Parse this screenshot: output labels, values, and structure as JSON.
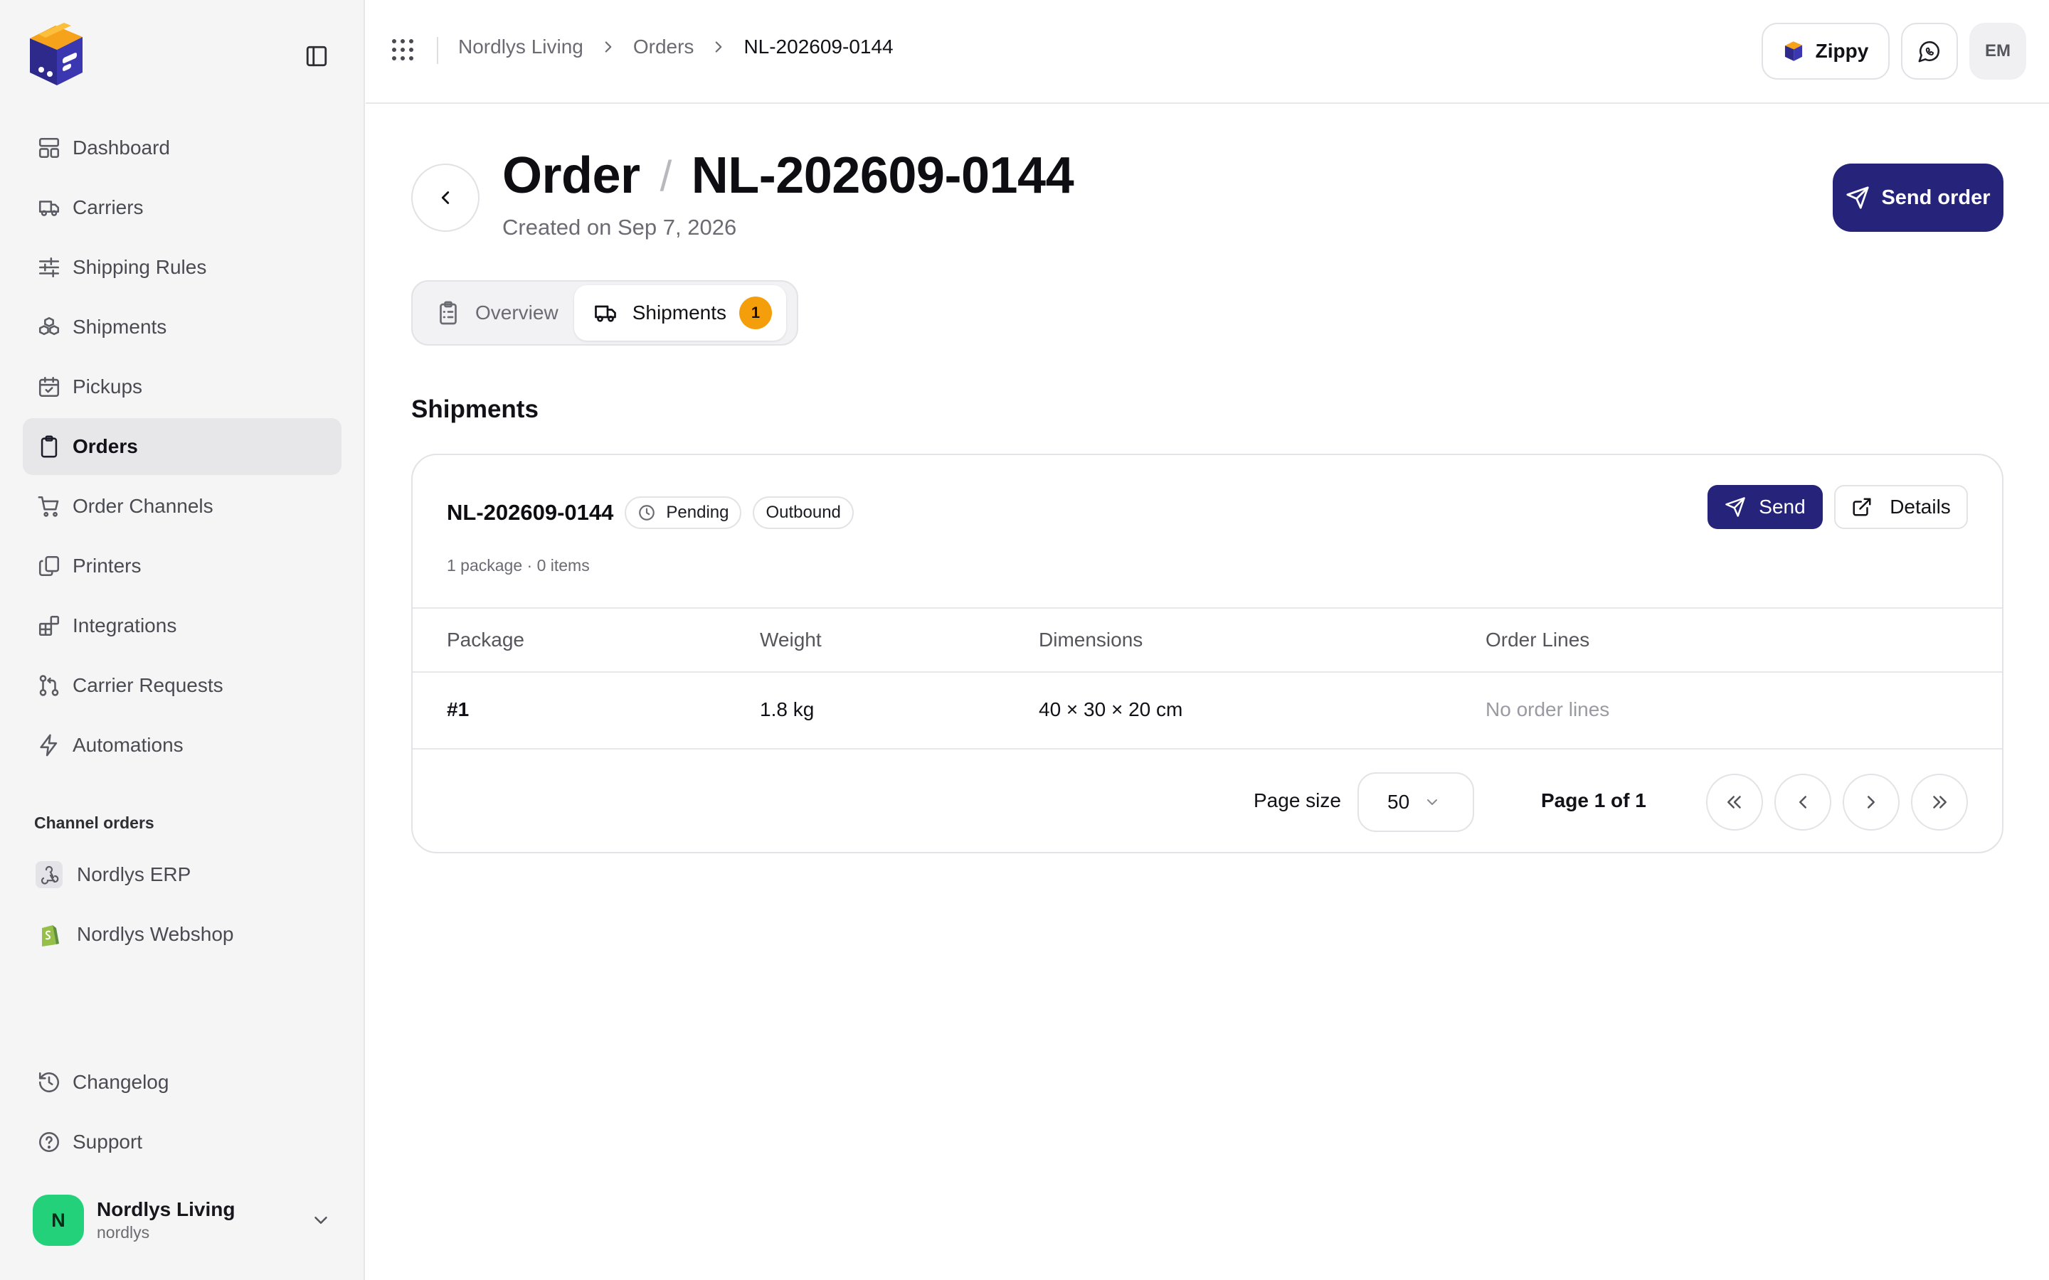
{
  "sidebar": {
    "nav_items": [
      {
        "label": "Dashboard",
        "icon": "layout-dashboard-icon"
      },
      {
        "label": "Carriers",
        "icon": "truck-icon"
      },
      {
        "label": "Shipping Rules",
        "icon": "sliders-icon"
      },
      {
        "label": "Shipments",
        "icon": "boxes-icon"
      },
      {
        "label": "Pickups",
        "icon": "calendar-check-icon"
      },
      {
        "label": "Orders",
        "icon": "clipboard-icon",
        "active": true
      },
      {
        "label": "Order Channels",
        "icon": "shopping-cart-icon"
      },
      {
        "label": "Printers",
        "icon": "copy-icon"
      },
      {
        "label": "Integrations",
        "icon": "blocks-icon"
      },
      {
        "label": "Carrier Requests",
        "icon": "git-pull-request-icon"
      },
      {
        "label": "Automations",
        "icon": "zap-icon"
      }
    ],
    "channel_section_label": "Channel orders",
    "channels": [
      {
        "label": "Nordlys ERP",
        "icon": "webhook-icon"
      },
      {
        "label": "Nordlys Webshop",
        "icon": "shopify-icon"
      }
    ],
    "bottom_items": [
      {
        "label": "Changelog",
        "icon": "history-icon"
      },
      {
        "label": "Support",
        "icon": "help-circle-icon"
      }
    ],
    "account": {
      "initial": "N",
      "name": "Nordlys Living",
      "handle": "nordlys",
      "avatar_color": "#22d17a"
    }
  },
  "topbar": {
    "breadcrumb": [
      "Nordlys Living",
      "Orders",
      "NL-202609-0144"
    ],
    "org_button_label": "Zippy",
    "user_initials": "EM"
  },
  "page": {
    "title_prefix": "Order",
    "title_separator": "/",
    "title_id": "NL-202609-0144",
    "subtitle": "Created on Sep 7, 2026",
    "send_order_label": "Send order",
    "accent_color": "#25247a"
  },
  "tabs": [
    {
      "label": "Overview",
      "icon": "clipboard-list-icon"
    },
    {
      "label": "Shipments",
      "icon": "truck-icon",
      "badge": "1",
      "active": true
    }
  ],
  "shipments": {
    "section_title": "Shipments",
    "card": {
      "id": "NL-202609-0144",
      "status": "Pending",
      "direction": "Outbound",
      "meta": "1 package · 0 items",
      "send_label": "Send",
      "details_label": "Details"
    },
    "table": {
      "columns": [
        "Package",
        "Weight",
        "Dimensions",
        "Order Lines"
      ],
      "rows": [
        [
          "#1",
          "1.8 kg",
          "40 × 30 × 20 cm",
          "No order lines"
        ]
      ]
    },
    "pagination": {
      "page_size_label": "Page size",
      "page_size_value": "50",
      "page_info": "Page 1 of 1"
    }
  }
}
